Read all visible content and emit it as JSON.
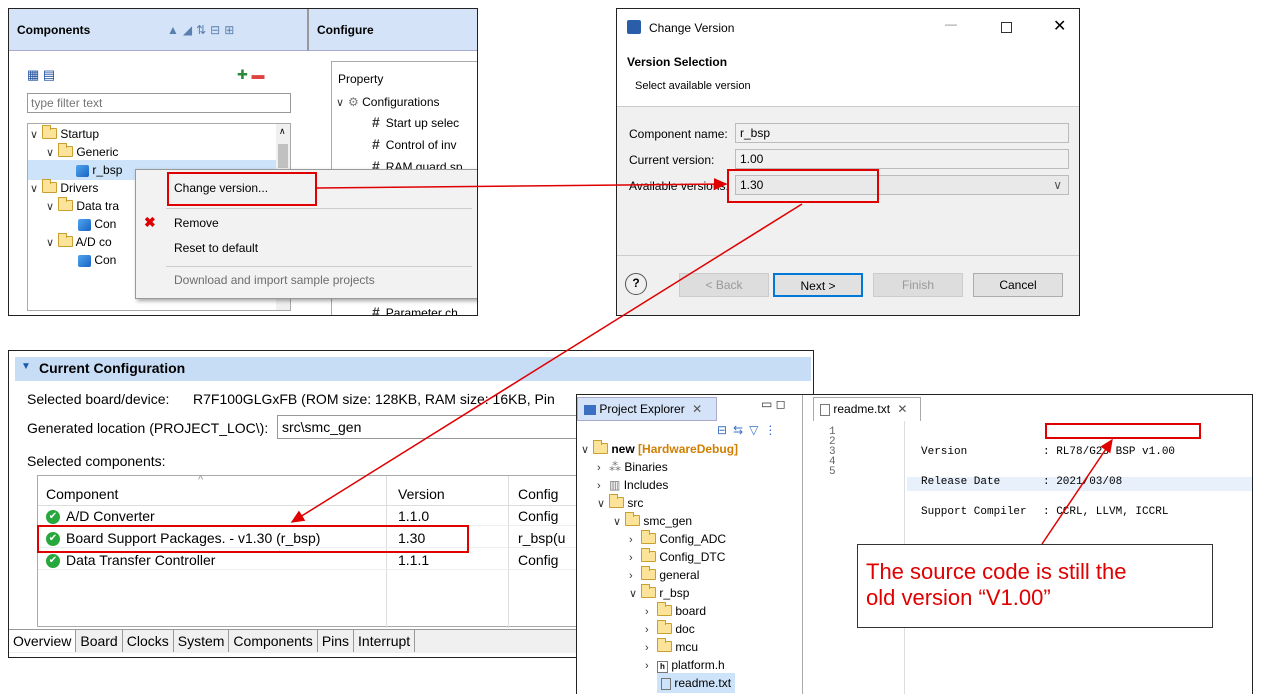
{
  "components_panel": {
    "title": "Components",
    "filter_placeholder": "type filter text",
    "tree": [
      {
        "label": "Startup"
      },
      {
        "label": "Generic"
      },
      {
        "label": "r_bsp"
      },
      {
        "label": "Drivers"
      },
      {
        "label": "Data tra"
      },
      {
        "label": "Con"
      },
      {
        "label": "A/D co"
      },
      {
        "label": "Con"
      }
    ]
  },
  "configure_panel": {
    "title": "Configure",
    "property_header": "Property",
    "configurations_label": "Configurations",
    "items": [
      "Start up selec",
      "Control of inv",
      "RAM guard sp"
    ],
    "bottom_item": "Parameter ch"
  },
  "context_menu": {
    "items": [
      {
        "label": "Change version...",
        "enabled": true
      },
      {
        "label": "Remove",
        "enabled": true
      },
      {
        "label": "Reset to default",
        "enabled": true
      },
      {
        "label": "Download and import sample projects",
        "enabled": false
      }
    ]
  },
  "change_version_dialog": {
    "window_title": "Change Version",
    "heading": "Version Selection",
    "subheading": "Select available version",
    "component_name_label": "Component name:",
    "component_name_value": "r_bsp",
    "current_version_label": "Current version:",
    "current_version_value": "1.00",
    "available_versions_label": "Available versions:",
    "available_versions_value": "1.30",
    "buttons": {
      "help": "?",
      "back": "< Back",
      "next": "Next >",
      "finish": "Finish",
      "cancel": "Cancel"
    }
  },
  "current_configuration": {
    "section_title": "Current Configuration",
    "board_label": "Selected board/device:",
    "board_value": "R7F100GLGxFB (ROM size: 128KB, RAM size: 16KB, Pin",
    "location_label": "Generated location (PROJECT_LOC\\):",
    "location_value": "src\\smc_gen",
    "selected_components_label": "Selected components:",
    "columns": [
      "Component",
      "Version",
      "Config"
    ],
    "rows": [
      {
        "component": "A/D Converter",
        "version": "1.1.0",
        "config": "Config"
      },
      {
        "component": "Board Support Packages. - v1.30 (r_bsp)",
        "version": "1.30",
        "config": "r_bsp(u"
      },
      {
        "component": "Data Transfer Controller",
        "version": "1.1.1",
        "config": "Config"
      }
    ],
    "tabs": [
      "Overview",
      "Board",
      "Clocks",
      "System",
      "Components",
      "Pins",
      "Interrupt"
    ]
  },
  "project_explorer": {
    "title": "Project Explorer",
    "tree": [
      {
        "label": "new"
      },
      {
        "label": "[HardwareDebug]"
      },
      {
        "label": "Binaries"
      },
      {
        "label": "Includes"
      },
      {
        "label": "src"
      },
      {
        "label": "smc_gen"
      },
      {
        "label": "Config_ADC"
      },
      {
        "label": "Config_DTC"
      },
      {
        "label": "general"
      },
      {
        "label": "r_bsp"
      },
      {
        "label": "board"
      },
      {
        "label": "doc"
      },
      {
        "label": "mcu"
      },
      {
        "label": "platform.h"
      },
      {
        "label": "readme.txt"
      }
    ]
  },
  "editor": {
    "tab_label": "readme.txt",
    "line_numbers": [
      "1",
      "2",
      "3",
      "4",
      "5"
    ],
    "lines": [
      {
        "key": "Version",
        "value": ": RL78/G23 BSP v1.00"
      },
      {
        "key": "Release Date",
        "value": ": 2021/03/08"
      },
      {
        "key": "Support Compiler",
        "value": ": CCRL, LLVM, ICCRL"
      }
    ]
  },
  "callout": {
    "text_line1": "The source code is still the",
    "text_line2": "old version “V1.00”"
  },
  "colors": {
    "annotation_red": "#e00000",
    "header_blue": "#d4e3f7",
    "config_header_blue": "#c7dcf5",
    "link_orange": "#d07f00"
  }
}
